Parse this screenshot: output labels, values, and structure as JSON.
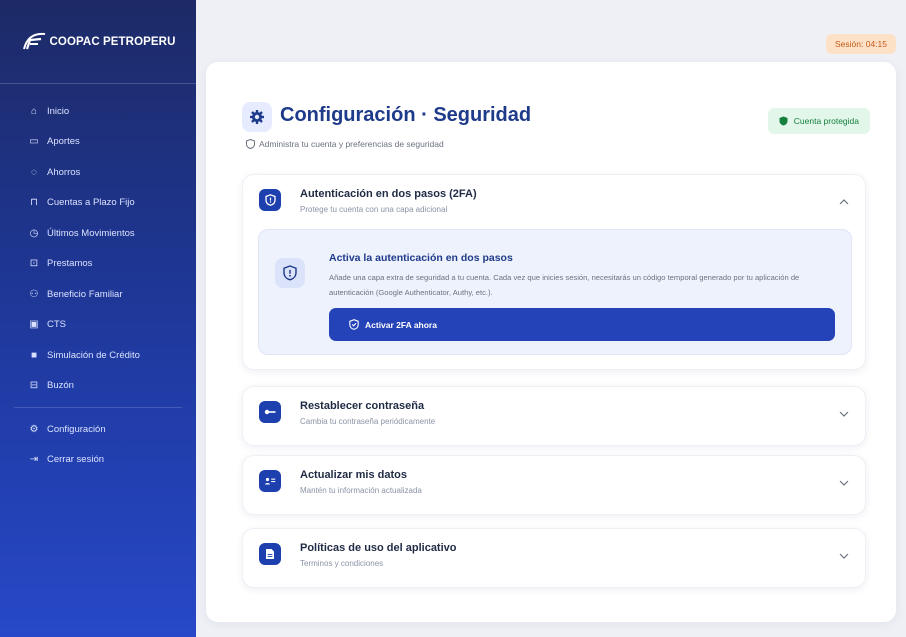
{
  "app": {
    "brand": "COOPAC PETROPERU"
  },
  "session": {
    "label": "Sesión: 04:15"
  },
  "sidebar": {
    "items": [
      {
        "label": "Inicio",
        "icon": "home-icon"
      },
      {
        "label": "Aportes",
        "icon": "wallet-icon"
      },
      {
        "label": "Ahorros",
        "icon": "piggy-bank-icon"
      },
      {
        "label": "Cuentas a Plazo Fijo",
        "icon": "lock-icon"
      },
      {
        "label": "Últimos Movimientos",
        "icon": "clock-icon"
      },
      {
        "label": "Prestamos",
        "icon": "loan-icon"
      },
      {
        "label": "Beneficio Familiar",
        "icon": "family-icon"
      },
      {
        "label": "CTS",
        "icon": "briefcase-icon"
      },
      {
        "label": "Simulación de Crédito",
        "icon": "calculator-icon"
      },
      {
        "label": "Buzón",
        "icon": "inbox-icon"
      }
    ],
    "settings_label": "Configuración",
    "logout_label": "Cerrar sesión"
  },
  "header": {
    "title": "Configuración · Seguridad",
    "subtitle": "Administra tu cuenta y preferencias de seguridad",
    "status_badge": "Cuenta protegida"
  },
  "sections": {
    "twofa": {
      "title": "Autenticación en dos pasos (2FA)",
      "subtitle": "Protege tu cuenta con una capa adicional",
      "panel_title": "Activa la autenticación en dos pasos",
      "panel_desc": "Añade una capa extra de seguridad a tu cuenta. Cada vez que inicies sesión, necesitarás un código temporal generado por tu aplicación de autenticación (Google Authenticator, Authy, etc.).",
      "button": "Activar 2FA ahora"
    },
    "password": {
      "title": "Restablecer contraseña",
      "subtitle": "Cambia tu contraseña periódicamente"
    },
    "profile": {
      "title": "Actualizar mis datos",
      "subtitle": "Mantén tu información actualizada"
    },
    "policies": {
      "title": "Políticas de uso del aplicativo",
      "subtitle": "Terminos y condiciones"
    }
  },
  "colors": {
    "primary": "#1e40af",
    "sidebar_top": "#1d2a66",
    "sidebar_bottom": "#2748c8",
    "success": "#15803d",
    "session_bg": "#fde1c7"
  }
}
